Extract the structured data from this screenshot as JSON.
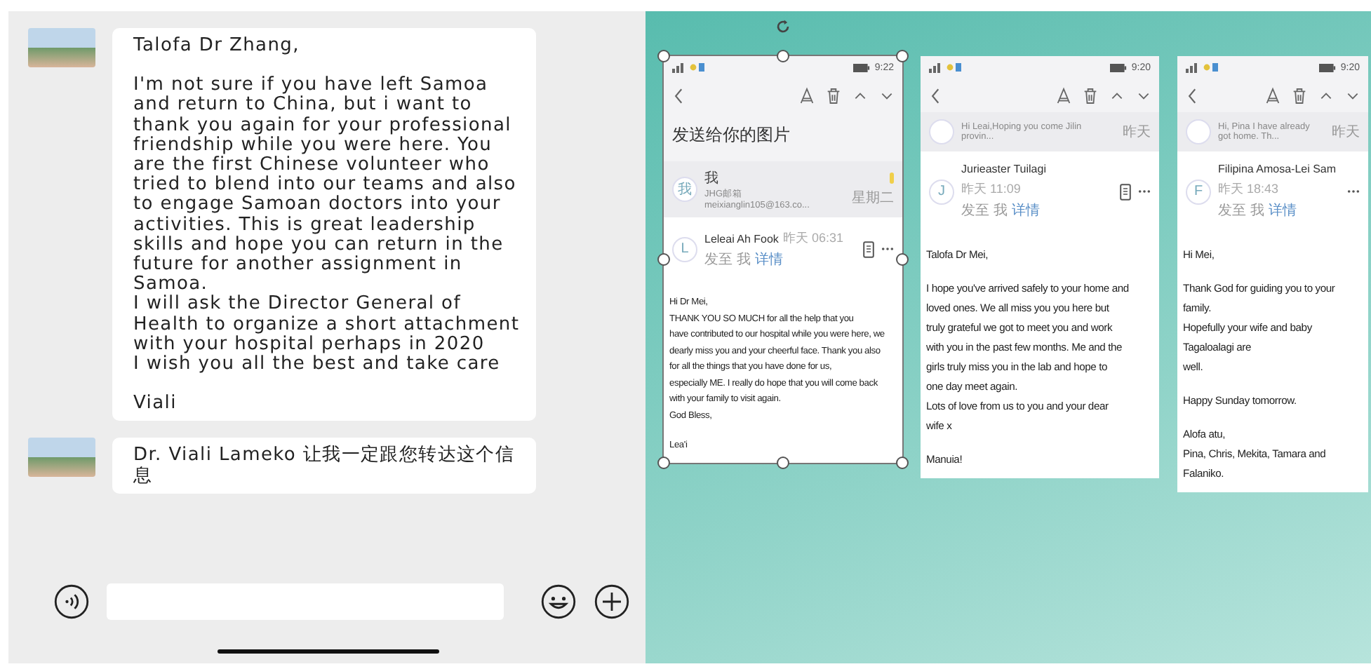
{
  "chat": {
    "messages": [
      {
        "paragraphs": [
          "Talofa Dr Zhang,",
          "I'm not sure if you have left Samoa and return to China, but i want to thank you again for your professional friendship while you were here. You are the first Chinese volunteer who tried to blend into our teams and also to engage Samoan doctors into your activities. This is great leadership skills and hope you can return in the future for another assignment in Samoa.\nI will ask the Director General of Health to organize a short attachment with your hospital perhaps in 2020\nI wish you all the best and take care",
          "Viali"
        ]
      },
      {
        "paragraphs": [
          "Dr. Viali Lameko  让我一定跟您转达这个信息"
        ]
      }
    ]
  },
  "mails": [
    {
      "selected": true,
      "time": "9:22",
      "subject": "发送给你的图片",
      "previous": {
        "avatar": "我",
        "sender": "我",
        "preview": "JHG邮箱meixianglin105@163.co...",
        "date": "星期二",
        "flagged": true
      },
      "avatar": "L",
      "sender": "Leleai Ah Fook",
      "sent": "昨天 06:31",
      "to": "发至 我",
      "details": "详情",
      "attachment": true,
      "paragraphs": [
        [
          "Hi Dr Mei,",
          "THANK YOU SO MUCH for all the help that you",
          "have contributed to our hospital while you were here, we",
          "dearly miss you and your cheerful face. Thank you also",
          "for all the things that you have done for us,",
          "especially ME. I really do hope that you will come back",
          "with your family to visit again.",
          "God Bless,"
        ],
        [
          "Lea'i"
        ]
      ]
    },
    {
      "selected": false,
      "time": "9:20",
      "previous": {
        "preview": "Hi Leai,Hoping you come Jilin provin...",
        "date": "昨天",
        "flagged": false
      },
      "avatar": "J",
      "sender": "Jurieaster Tuilagi",
      "sent": "昨天 11:09",
      "to": "发至 我",
      "details": "详情",
      "attachment": true,
      "paragraphs": [
        [
          "Talofa Dr Mei,"
        ],
        [
          "I hope you've arrived safely to your home and",
          "loved ones. We all miss you you here but",
          "truly grateful we got to meet you and work",
          "with you in the past few months. Me and the",
          "girls truly miss you in the lab and hope to",
          "one day meet again.",
          "Lots of love from us to you and your dear",
          "wife x"
        ],
        [
          "Manuia!"
        ]
      ]
    },
    {
      "selected": false,
      "time": "9:20",
      "previous": {
        "preview": "Hi, Pina I have already got home. Th...",
        "date": "昨天",
        "flagged": false
      },
      "avatar": "F",
      "sender": "Filipina Amosa-Lei Sam",
      "sent": "昨天 18:43",
      "to": "发至 我",
      "details": "详情",
      "attachment": false,
      "paragraphs": [
        [
          "Hi Mei,"
        ],
        [
          "Thank God for guiding you to your family.",
          "Hopefully your wife and baby Tagaloalagi are",
          "well."
        ],
        [
          "Happy Sunday tomorrow."
        ],
        [
          "Alofa atu,",
          "Pina, Chris, Mekita, Tamara and Falaniko."
        ]
      ]
    }
  ]
}
